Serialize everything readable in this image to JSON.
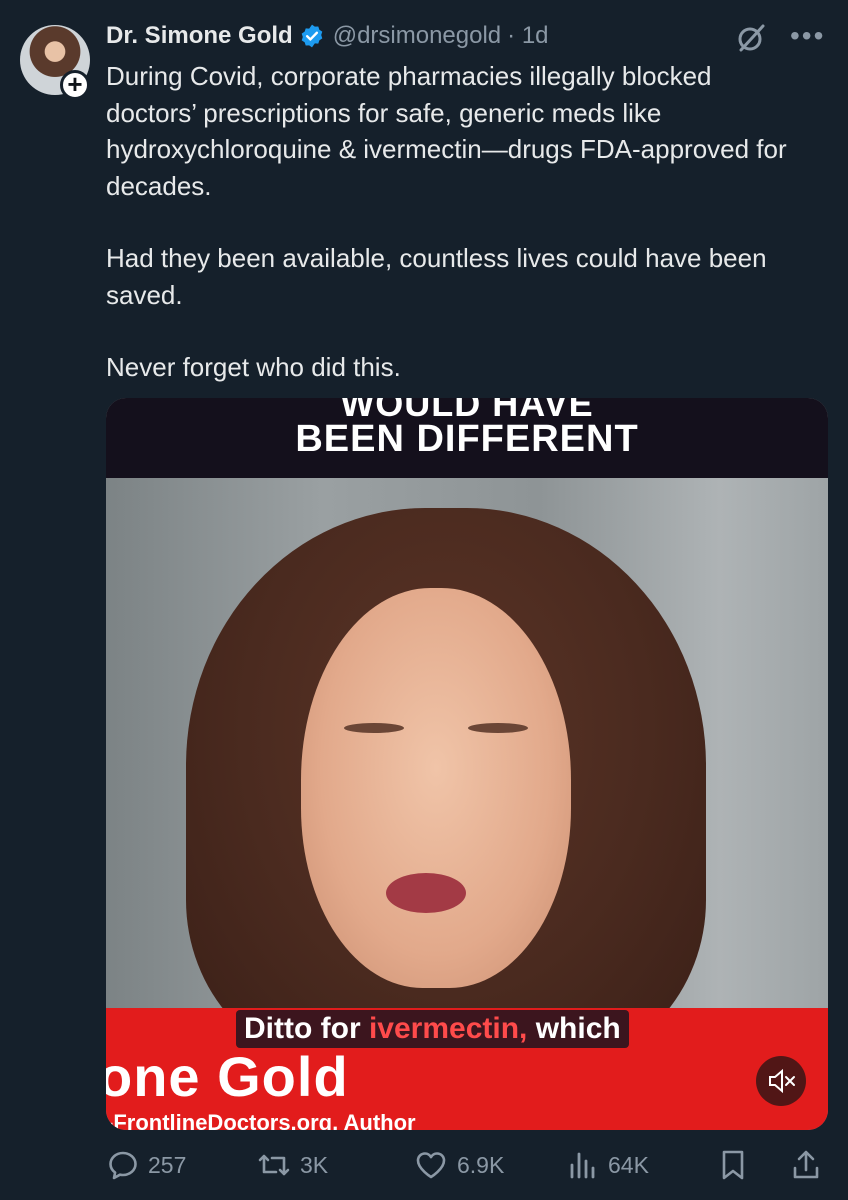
{
  "tweet": {
    "author_name": "Dr. Simone Gold",
    "handle": "@drsimonegold",
    "time": "· 1d",
    "paragraphs": [
      "During Covid, corporate pharmacies illegally blocked doctors’ prescriptions for safe, generic meds like hydroxychloroquine & ivermectin—drugs FDA-approved for decades.",
      "Had they been available, countless lives could have been saved.",
      "Never forget who did this."
    ]
  },
  "video": {
    "top_banner_cut": "WOULD HAVE",
    "top_banner": "BEEN DIFFERENT",
    "caption_pre": "Ditto for ",
    "caption_highlight": "ivermectin,",
    "caption_post": " which",
    "name_plate": "one Gold",
    "sub_plate": "-FrontlineDoctors.org, Author",
    "mute_icon": "speaker-muted-icon"
  },
  "actions": {
    "replies": "257",
    "reposts": "3K",
    "likes": "6.9K",
    "views": "64K"
  },
  "colors": {
    "background": "#15202b",
    "secondary_text": "#8b98a5",
    "verified": "#1d9bf0",
    "banner_red": "#e21c1c"
  }
}
